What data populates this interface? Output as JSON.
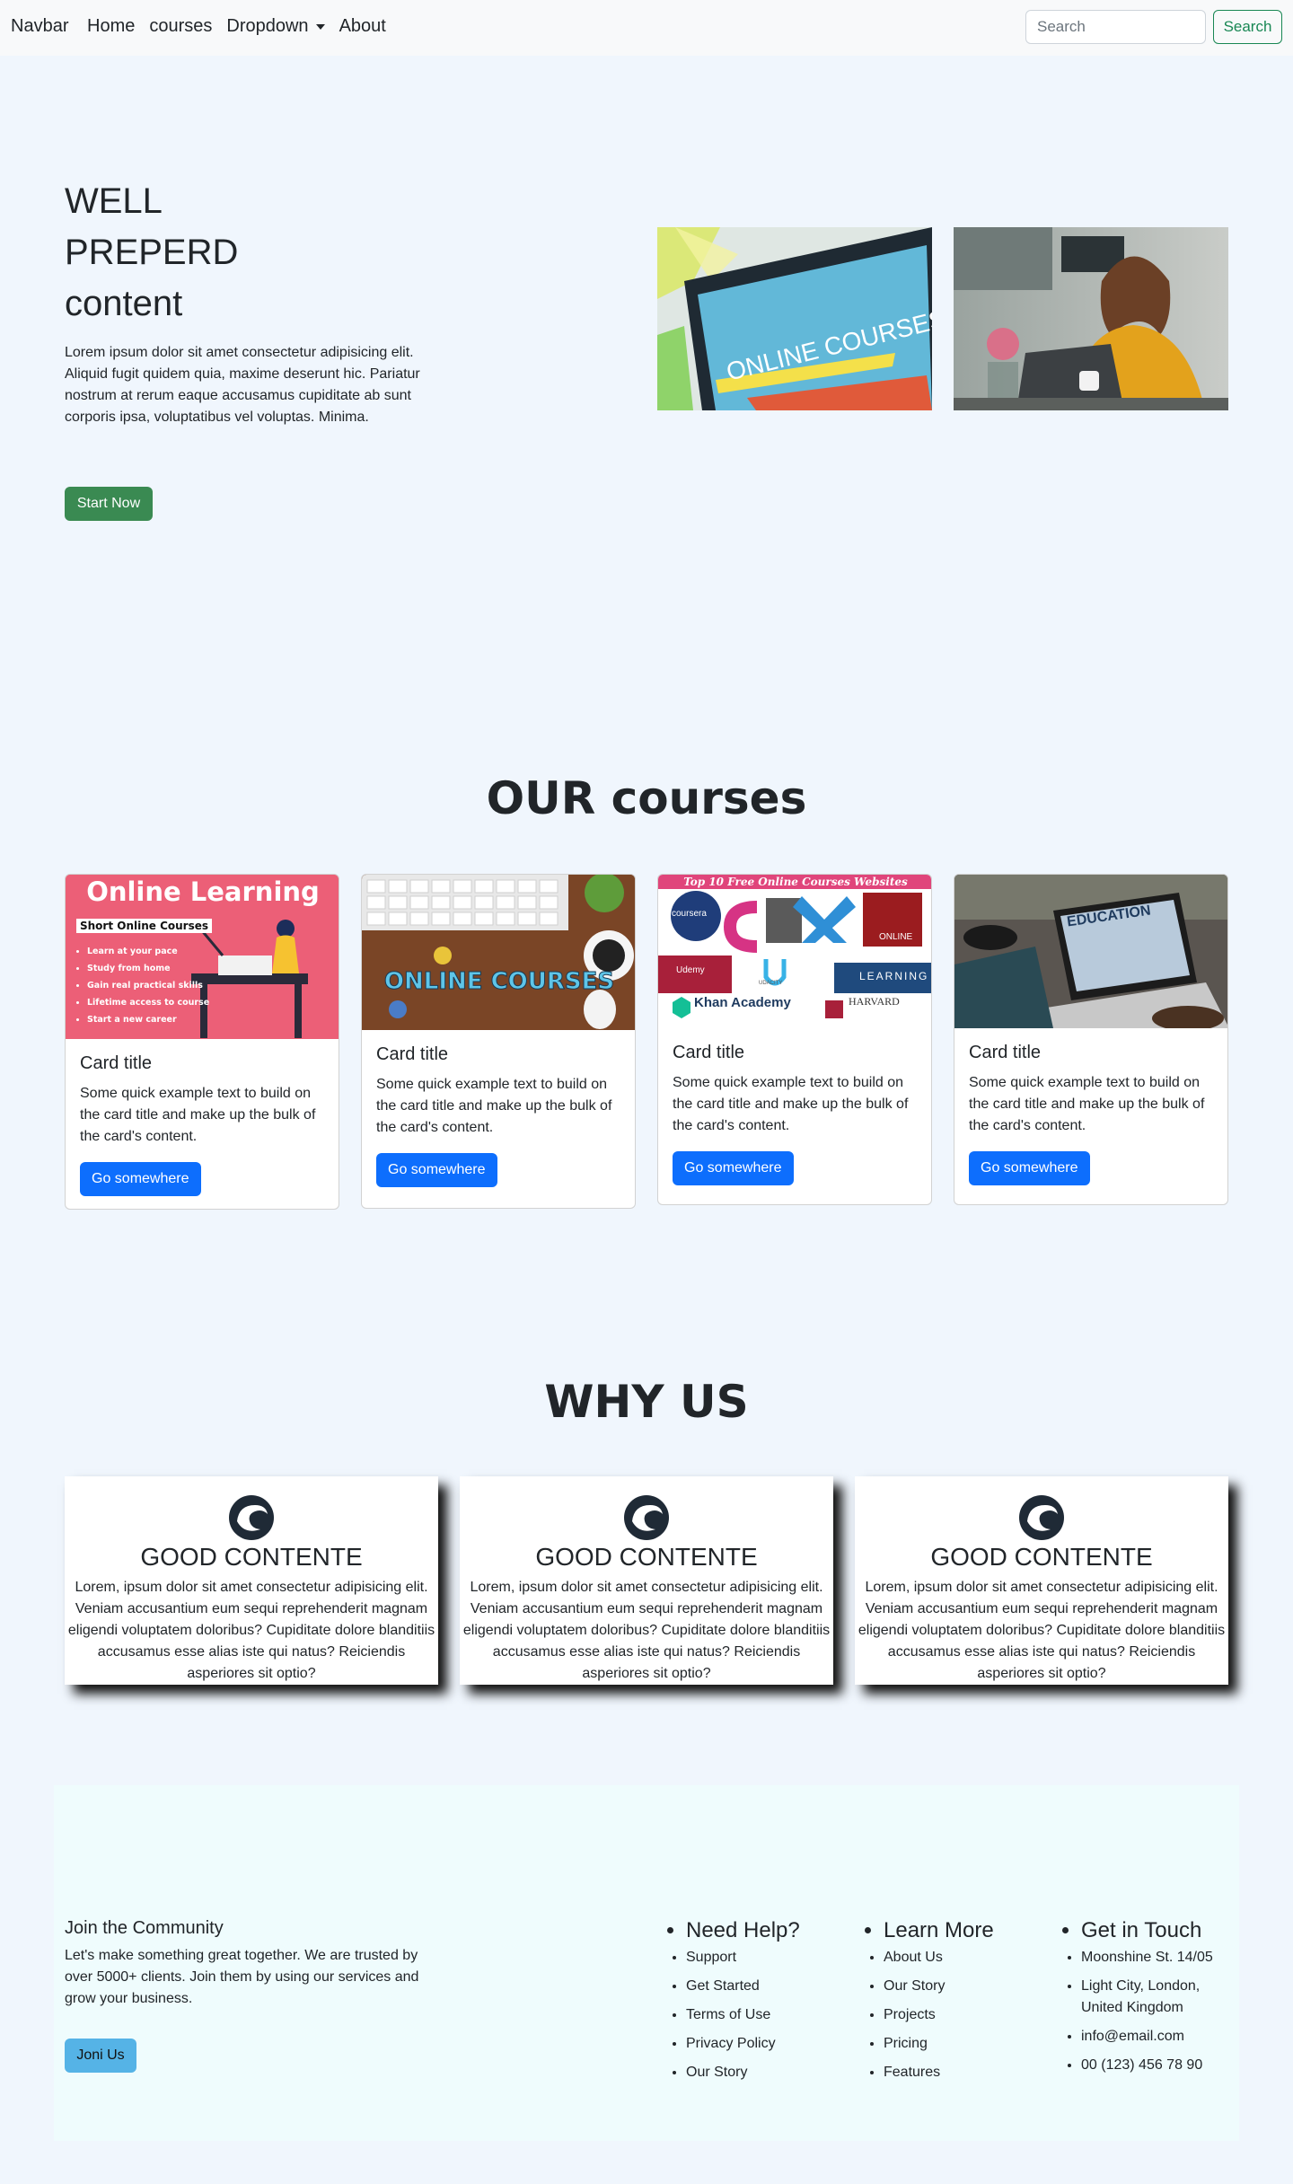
{
  "navbar": {
    "brand": "Navbar",
    "links": [
      "Home",
      "courses",
      "Dropdown",
      "About"
    ],
    "search_placeholder": "Search",
    "search_button": "Search"
  },
  "hero": {
    "title": "WELL PREPERD content",
    "text": "Lorem ipsum dolor sit amet consectetur adipisicing elit. Aliquid fugit quidem quia, maxime deserunt hic. Pariatur nostrum at rerum eaque accusamus cupiditate ab sunt corporis ipsa, voluptatibus vel voluptas. Minima.",
    "button": "Start Now",
    "image1_text": "ONLINE COURSES"
  },
  "courses": {
    "heading": "OUR courses",
    "cards": [
      {
        "title": "Card title",
        "text": "Some quick example text to build on the card title and make up the bulk of the card's content.",
        "button": "Go somewhere",
        "img_title": "Online Learning",
        "img_sub": "Short Online Courses",
        "img_items": [
          "Learn at your pace",
          "Study from home",
          "Gain real practical skills",
          "Lifetime access to course",
          "Start a new career"
        ]
      },
      {
        "title": "Card title",
        "text": "Some quick example text to build on the card title and make up the bulk of the card's content.",
        "button": "Go somewhere",
        "img_title": "ONLINE COURSES"
      },
      {
        "title": "Card title",
        "text": "Some quick example text to build on the card title and make up the bulk of the card's content.",
        "button": "Go somewhere",
        "img_title": "Top 10 Free Online Courses Websites",
        "img_logos": [
          "coursera",
          "edX",
          "ONLINE",
          "Udemy",
          "UDACITY",
          "LEARNING",
          "Khan Academy",
          "HARVARD"
        ]
      },
      {
        "title": "Card title",
        "text": "Some quick example text to build on the card title and make up the bulk of the card's content.",
        "button": "Go somewhere",
        "img_title": "EDUCATION"
      }
    ]
  },
  "why": {
    "heading": "WHY US",
    "items": [
      {
        "title": "GOOD CONTENTE",
        "text": "Lorem, ipsum dolor sit amet consectetur adipisicing elit. Veniam accusantium eum sequi reprehenderit magnam eligendi voluptatem doloribus? Cupiditate dolore blanditiis accusamus esse alias iste qui natus? Reiciendis asperiores sit optio?"
      },
      {
        "title": "GOOD CONTENTE",
        "text": "Lorem, ipsum dolor sit amet consectetur adipisicing elit. Veniam accusantium eum sequi reprehenderit magnam eligendi voluptatem doloribus? Cupiditate dolore blanditiis accusamus esse alias iste qui natus? Reiciendis asperiores sit optio?"
      },
      {
        "title": "GOOD CONTENTE",
        "text": "Lorem, ipsum dolor sit amet consectetur adipisicing elit. Veniam accusantium eum sequi reprehenderit magnam eligendi voluptatem doloribus? Cupiditate dolore blanditiis accusamus esse alias iste qui natus? Reiciendis asperiores sit optio?"
      }
    ]
  },
  "footer": {
    "join_title": "Join the Community",
    "join_text": "Let's make something great together. We are trusted by over 5000+ clients. Join them by using our services and grow your business.",
    "join_button": "Joni Us",
    "columns": [
      {
        "title": "Need Help?",
        "items": [
          "Support",
          "Get Started",
          "Terms of Use",
          "Privacy Policy",
          "Our Story"
        ]
      },
      {
        "title": "Learn More",
        "items": [
          "About Us",
          "Our Story",
          "Projects",
          "Pricing",
          "Features"
        ]
      },
      {
        "title": "Get in Touch",
        "items": [
          "Moonshine St. 14/05",
          "Light City, London, United Kingdom",
          "info@email.com",
          "00 (123) 456 78 90"
        ]
      }
    ]
  },
  "colors": {
    "page_bg": "#f0f6fd",
    "success": "#198754",
    "primary": "#0d6efd",
    "footer_bg": "#effcfd",
    "join_btn": "#55b3e6"
  }
}
